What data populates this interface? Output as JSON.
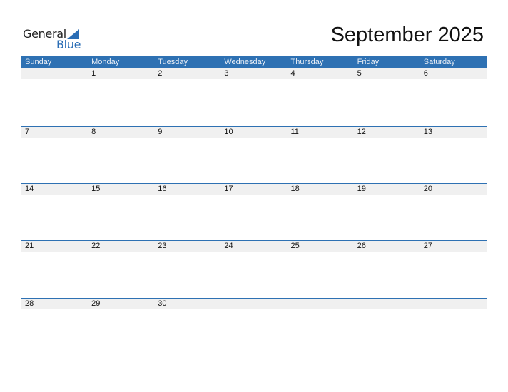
{
  "logo": {
    "general": "General",
    "blue": "Blue",
    "icon": "triangle-icon"
  },
  "title": "September 2025",
  "colors": {
    "accent": "#2e71b3",
    "stripe": "#f0f0f0"
  },
  "weekdays": [
    "Sunday",
    "Monday",
    "Tuesday",
    "Wednesday",
    "Thursday",
    "Friday",
    "Saturday"
  ],
  "weeks": [
    [
      "",
      "1",
      "2",
      "3",
      "4",
      "5",
      "6"
    ],
    [
      "7",
      "8",
      "9",
      "10",
      "11",
      "12",
      "13"
    ],
    [
      "14",
      "15",
      "16",
      "17",
      "18",
      "19",
      "20"
    ],
    [
      "21",
      "22",
      "23",
      "24",
      "25",
      "26",
      "27"
    ],
    [
      "28",
      "29",
      "30",
      "",
      "",
      "",
      ""
    ]
  ]
}
